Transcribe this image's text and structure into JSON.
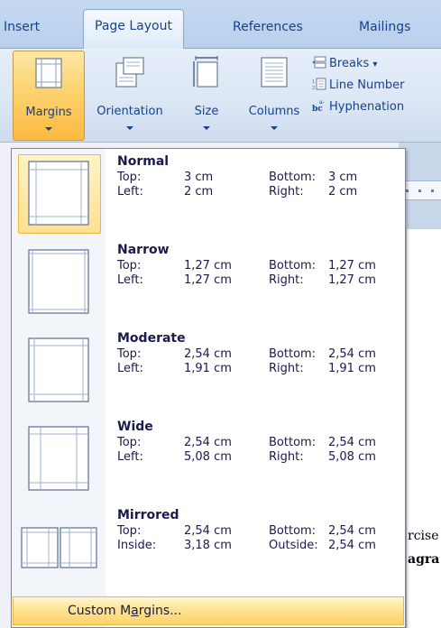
{
  "ribbon": {
    "tabs": [
      {
        "label": "Insert"
      },
      {
        "label": "Page Layout"
      },
      {
        "label": "References"
      },
      {
        "label": "Mailings"
      }
    ],
    "buttons": {
      "margins": "Margins",
      "orientation": "Orientation",
      "size": "Size",
      "columns": "Columns"
    },
    "small_items": {
      "breaks": "Breaks",
      "line_numbers": "Line Number",
      "hyphenation": "Hyphenation"
    }
  },
  "document": {
    "line1": "rcise",
    "line2": "agra"
  },
  "menu": {
    "items": [
      {
        "title": "Normal",
        "row1": {
          "label_a": "Top:",
          "value_a": "3 cm",
          "label_b": "Bottom:",
          "value_b": "3 cm"
        },
        "row2": {
          "label_a": "Left:",
          "value_a": "2 cm",
          "label_b": "Right:",
          "value_b": "2 cm"
        }
      },
      {
        "title": "Narrow",
        "row1": {
          "label_a": "Top:",
          "value_a": "1,27 cm",
          "label_b": "Bottom:",
          "value_b": "1,27 cm"
        },
        "row2": {
          "label_a": "Left:",
          "value_a": "1,27 cm",
          "label_b": "Right:",
          "value_b": "1,27 cm"
        }
      },
      {
        "title": "Moderate",
        "row1": {
          "label_a": "Top:",
          "value_a": "2,54 cm",
          "label_b": "Bottom:",
          "value_b": "2,54 cm"
        },
        "row2": {
          "label_a": "Left:",
          "value_a": "1,91 cm",
          "label_b": "Right:",
          "value_b": "1,91 cm"
        }
      },
      {
        "title": "Wide",
        "row1": {
          "label_a": "Top:",
          "value_a": "2,54 cm",
          "label_b": "Bottom:",
          "value_b": "2,54 cm"
        },
        "row2": {
          "label_a": "Left:",
          "value_a": "5,08 cm",
          "label_b": "Right:",
          "value_b": "5,08 cm"
        }
      },
      {
        "title": "Mirrored",
        "row1": {
          "label_a": "Top:",
          "value_a": "2,54 cm",
          "label_b": "Bottom:",
          "value_b": "2,54 cm"
        },
        "row2": {
          "label_a": "Inside:",
          "value_a": "3,18 cm",
          "label_b": "Outside:",
          "value_b": "2,54 cm"
        }
      }
    ],
    "custom_pre": "Custom M",
    "custom_mnemonic": "a",
    "custom_post": "rgins..."
  },
  "colors": {
    "accent": "#fdd26f",
    "ribbon_text": "#15428b",
    "selection_border": "#e8b93c"
  }
}
